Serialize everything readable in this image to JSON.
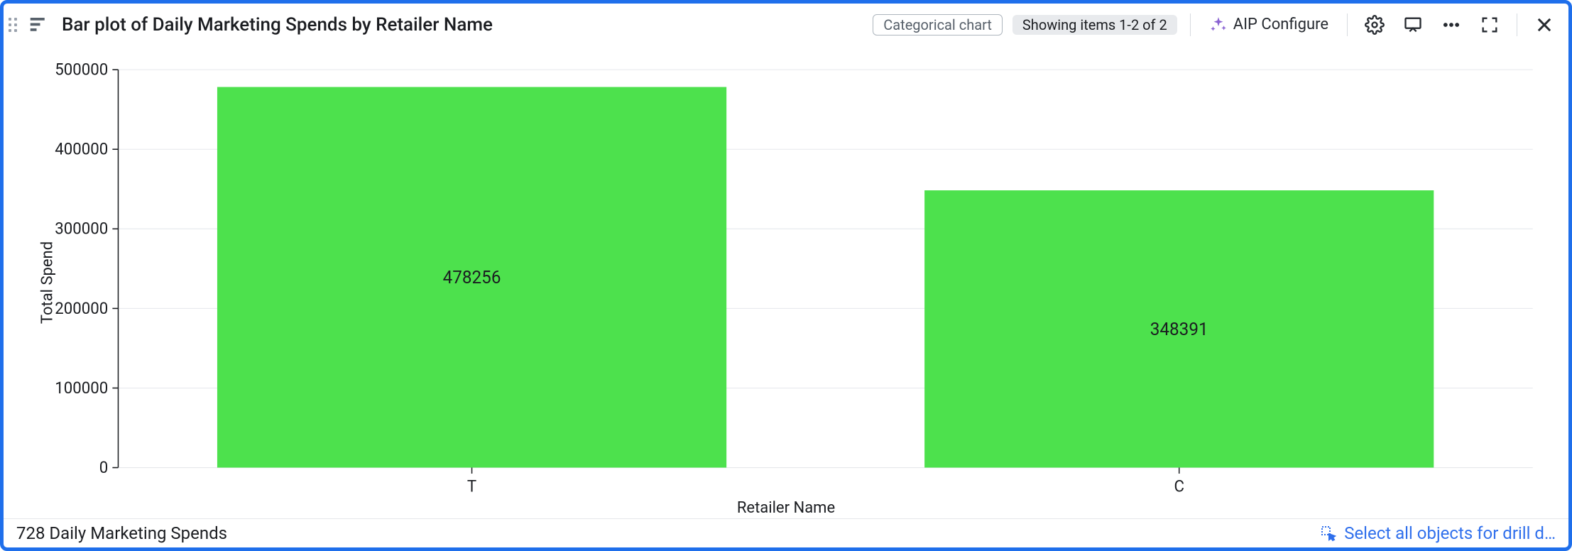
{
  "header": {
    "title": "Bar plot of Daily Marketing Spends by Retailer Name",
    "chart_type_tag": "Categorical chart",
    "count_tag": "Showing items 1-2 of 2",
    "aip_label": "AIP Configure"
  },
  "footer": {
    "summary": "728 Daily Marketing Spends",
    "drill_label": "Select all objects for drill d…"
  },
  "chart_data": {
    "type": "bar",
    "title": "Bar plot of Daily Marketing Spends by Retailer Name",
    "xlabel": "Retailer Name",
    "ylabel": "Total Spend",
    "categories": [
      "T",
      "C"
    ],
    "values": [
      478256,
      348391
    ],
    "ylim": [
      0,
      500000
    ],
    "yticks": [
      0,
      100000,
      200000,
      300000,
      400000,
      500000
    ],
    "bar_color": "#4de14d"
  }
}
